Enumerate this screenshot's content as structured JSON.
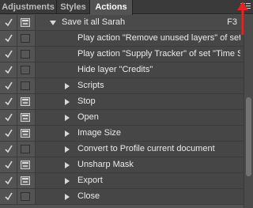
{
  "tabs": [
    {
      "label": "Adjustments",
      "active": false
    },
    {
      "label": "Styles",
      "active": false
    },
    {
      "label": "Actions",
      "active": true
    }
  ],
  "panel_menu_icon": "panel-menu-icon",
  "annotation_arrow_color": "#e8231f",
  "action_set": {
    "name": "Save it all Sarah",
    "shortcut": "F3",
    "expanded": true,
    "enabled": true,
    "dialog_toggle": true
  },
  "steps": [
    {
      "label": "Play action \"Remove unused layers\" of set \"T...",
      "expandable": false,
      "enabled": true,
      "dialog": false
    },
    {
      "label": "Play action \"Supply Tracker\" of set \"Time Sav...",
      "expandable": false,
      "enabled": true,
      "dialog": false
    },
    {
      "label": "Hide layer \"Credits\"",
      "expandable": false,
      "enabled": true,
      "dialog": false
    },
    {
      "label": "Scripts",
      "expandable": true,
      "enabled": true,
      "dialog": false
    },
    {
      "label": "Stop",
      "expandable": true,
      "enabled": true,
      "dialog": true
    },
    {
      "label": "Open",
      "expandable": true,
      "enabled": true,
      "dialog": true
    },
    {
      "label": "Image Size",
      "expandable": true,
      "enabled": true,
      "dialog": true
    },
    {
      "label": "Convert to Profile current document",
      "expandable": true,
      "enabled": true,
      "dialog": false
    },
    {
      "label": "Unsharp Mask",
      "expandable": true,
      "enabled": true,
      "dialog": true
    },
    {
      "label": "Export",
      "expandable": true,
      "enabled": true,
      "dialog": true
    },
    {
      "label": "Close",
      "expandable": true,
      "enabled": true,
      "dialog": false
    }
  ]
}
